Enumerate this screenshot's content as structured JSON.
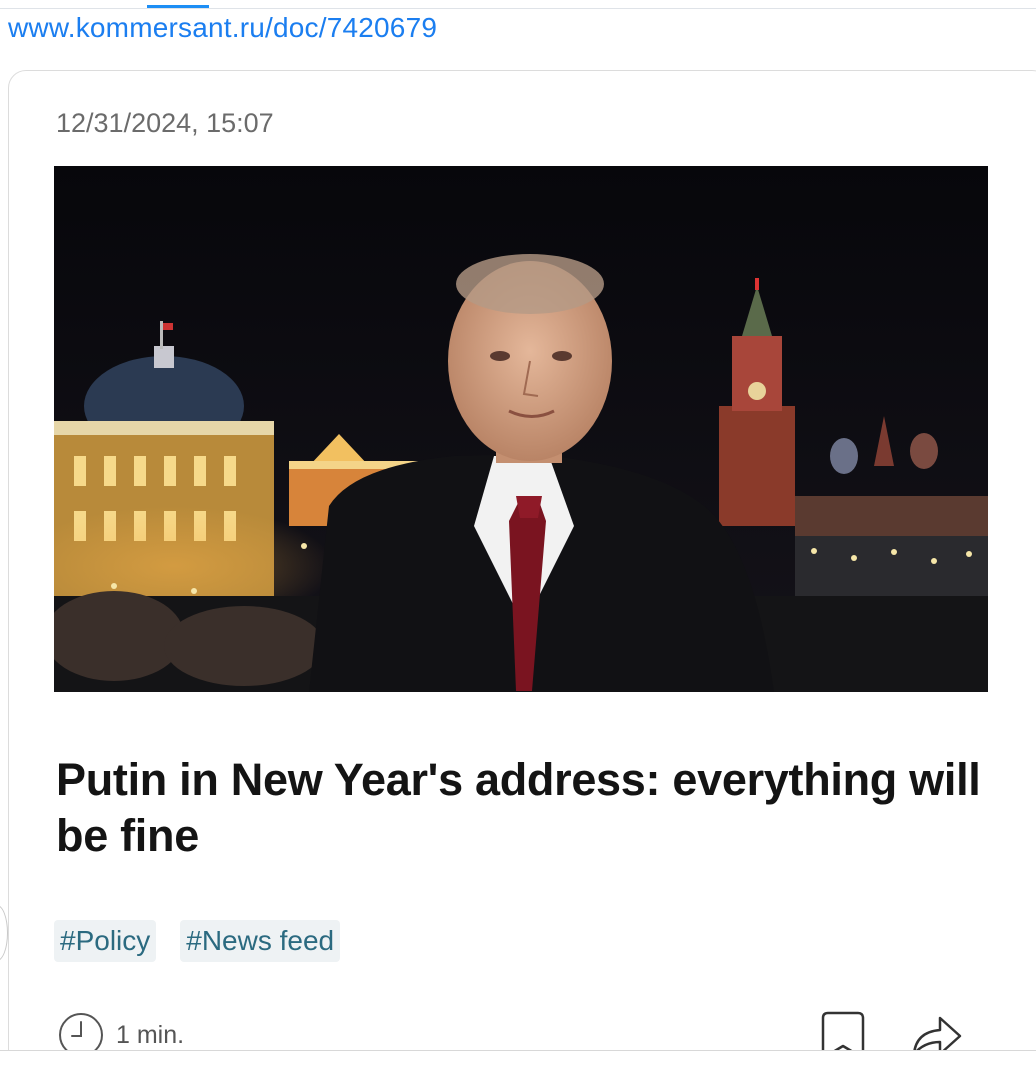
{
  "browser": {
    "url": "www.kommersant.ru/doc/7420679"
  },
  "article": {
    "timestamp": "12/31/2024, 15:07",
    "headline": "Putin in New Year's address: everything will be fine",
    "tags": [
      "#Policy",
      "#News feed"
    ],
    "read_time": "1 min."
  },
  "icons": {
    "clock": "clock-icon",
    "bookmark": "bookmark-icon",
    "share": "share-icon"
  },
  "colors": {
    "link": "#1b7ef0",
    "tag_text": "#2b6a80",
    "tag_bg": "#eef2f4",
    "headline": "#141414"
  }
}
